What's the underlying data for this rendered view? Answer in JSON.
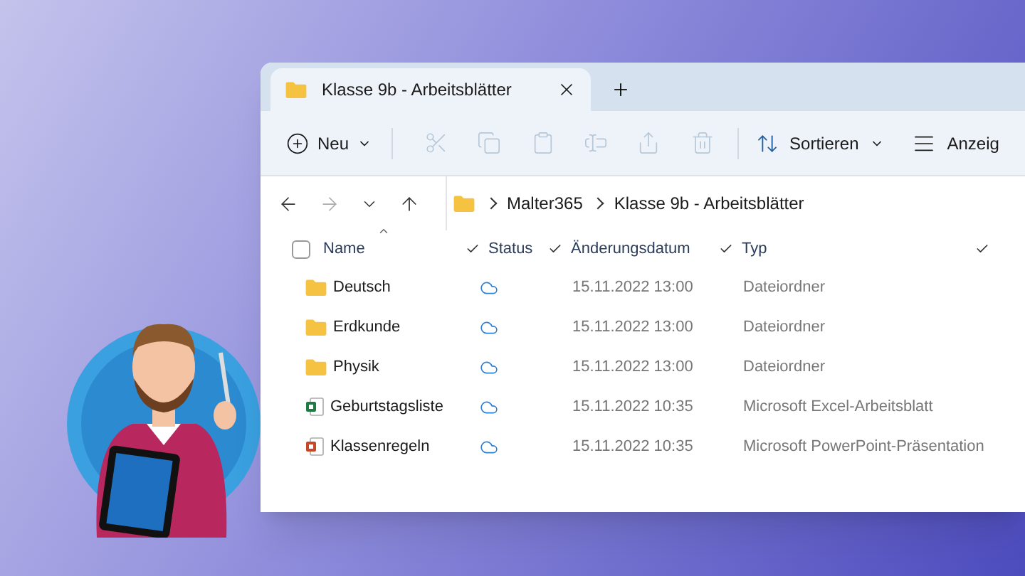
{
  "window": {
    "tabs": [
      {
        "title": "Klasse 9b - Arbeitsblätter",
        "selected": true
      }
    ]
  },
  "toolbar": {
    "new_button": "Neu",
    "actions": [
      {
        "kind": "cut",
        "disabled": true
      },
      {
        "kind": "copy",
        "disabled": true
      },
      {
        "kind": "paste",
        "disabled": true
      },
      {
        "kind": "rename",
        "disabled": true
      },
      {
        "kind": "share",
        "disabled": true
      },
      {
        "kind": "delete",
        "disabled": true
      }
    ],
    "sort_button": "Sortieren",
    "view_button": "Anzeig"
  },
  "navigation": {
    "back_disabled": false,
    "forward_disabled": true
  },
  "breadcrumbs": [
    "Malter365",
    "Klasse 9b - Arbeitsblätter"
  ],
  "select_all": {
    "checked": false
  },
  "columns": [
    "Name",
    "Status",
    "Änderungsdatum",
    "Typ"
  ],
  "rows": [
    {
      "kind": "folder",
      "name": "Deutsch",
      "modified": "15.11.2022 13:00",
      "type": "Dateiordner"
    },
    {
      "kind": "folder",
      "name": "Erdkunde",
      "modified": "15.11.2022 13:00",
      "type": "Dateiordner"
    },
    {
      "kind": "folder",
      "name": "Physik",
      "modified": "15.11.2022 13:00",
      "type": "Dateiordner"
    },
    {
      "kind": "excel",
      "name": "Geburtstagsliste",
      "modified": "15.11.2022 10:35",
      "type": "Microsoft Excel-Arbeitsblatt"
    },
    {
      "kind": "powerpoint",
      "name": "Klassenregeln",
      "modified": "15.11.2022 10:35",
      "type": "Microsoft PowerPoint-Präsentation"
    }
  ]
}
